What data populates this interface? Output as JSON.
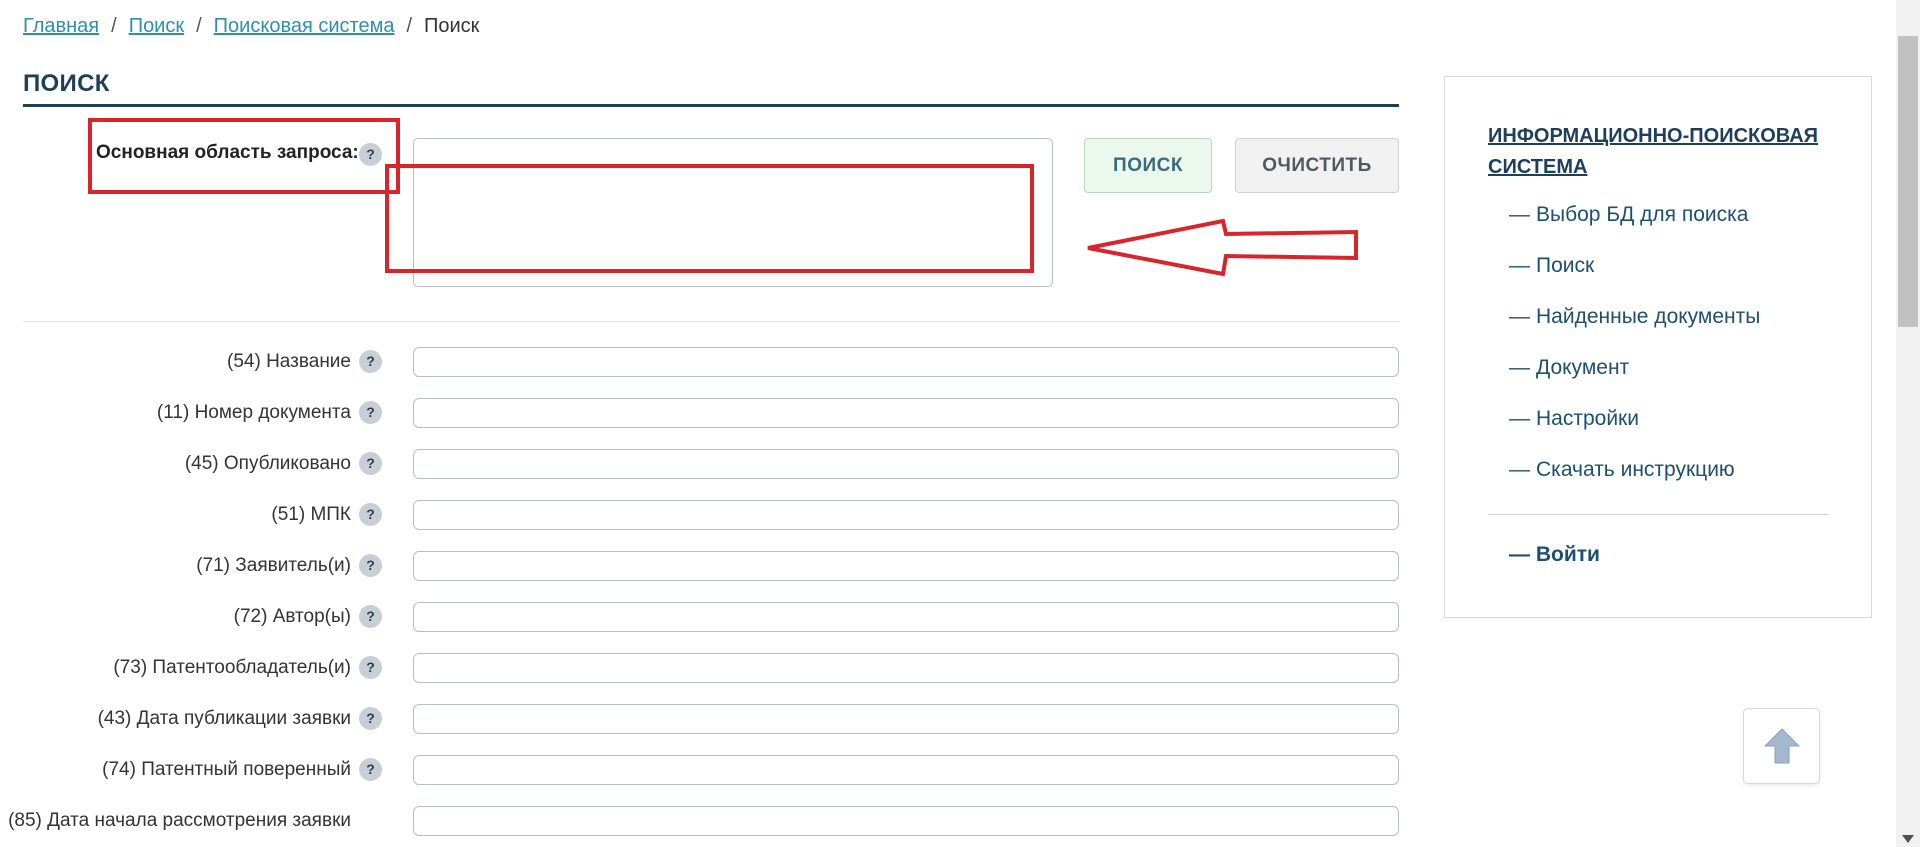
{
  "breadcrumb": {
    "items": [
      "Главная",
      "Поиск",
      "Поисковая система"
    ],
    "current": "Поиск",
    "separator": "/"
  },
  "page_title": "ПОИСК",
  "main_query": {
    "label": "Основная область запроса:",
    "help": "?",
    "value": ""
  },
  "buttons": {
    "search": "ПОИСК",
    "clear": "ОЧИСТИТЬ"
  },
  "fields": [
    {
      "label": "(54) Название",
      "help": "?",
      "value": ""
    },
    {
      "label": "(11) Номер документа",
      "help": "?",
      "value": ""
    },
    {
      "label": "(45) Опубликовано",
      "help": "?",
      "value": ""
    },
    {
      "label": "(51) МПК",
      "help": "?",
      "value": ""
    },
    {
      "label": "(71) Заявитель(и)",
      "help": "?",
      "value": ""
    },
    {
      "label": "(72) Автор(ы)",
      "help": "?",
      "value": ""
    },
    {
      "label": "(73) Патентообладатель(и)",
      "help": "?",
      "value": ""
    },
    {
      "label": "(43) Дата публикации заявки",
      "help": "?",
      "value": ""
    },
    {
      "label": "(74) Патентный поверенный",
      "help": "?",
      "value": ""
    },
    {
      "label": "(85) Дата начала рассмотрения заявки",
      "help": "?",
      "value": ""
    }
  ],
  "sidebar": {
    "title": "ИНФОРМАЦИОННО-ПОИСКОВАЯ СИСТЕМА",
    "dash": "—",
    "items": [
      "Выбор БД для поиска",
      "Поиск",
      "Найденные документы",
      "Документ",
      "Настройки",
      "Скачать инструкцию"
    ],
    "login": "Войти"
  },
  "colors": {
    "accent": "#1d3f5a",
    "link": "#2d8fb0",
    "annotation": "#d8252b",
    "search_button_bg": "#eaf8ee"
  },
  "icons": {
    "help": "question-mark-circle",
    "scroll_top": "arrow-up-icon",
    "annotation": "red-arrow-left"
  }
}
